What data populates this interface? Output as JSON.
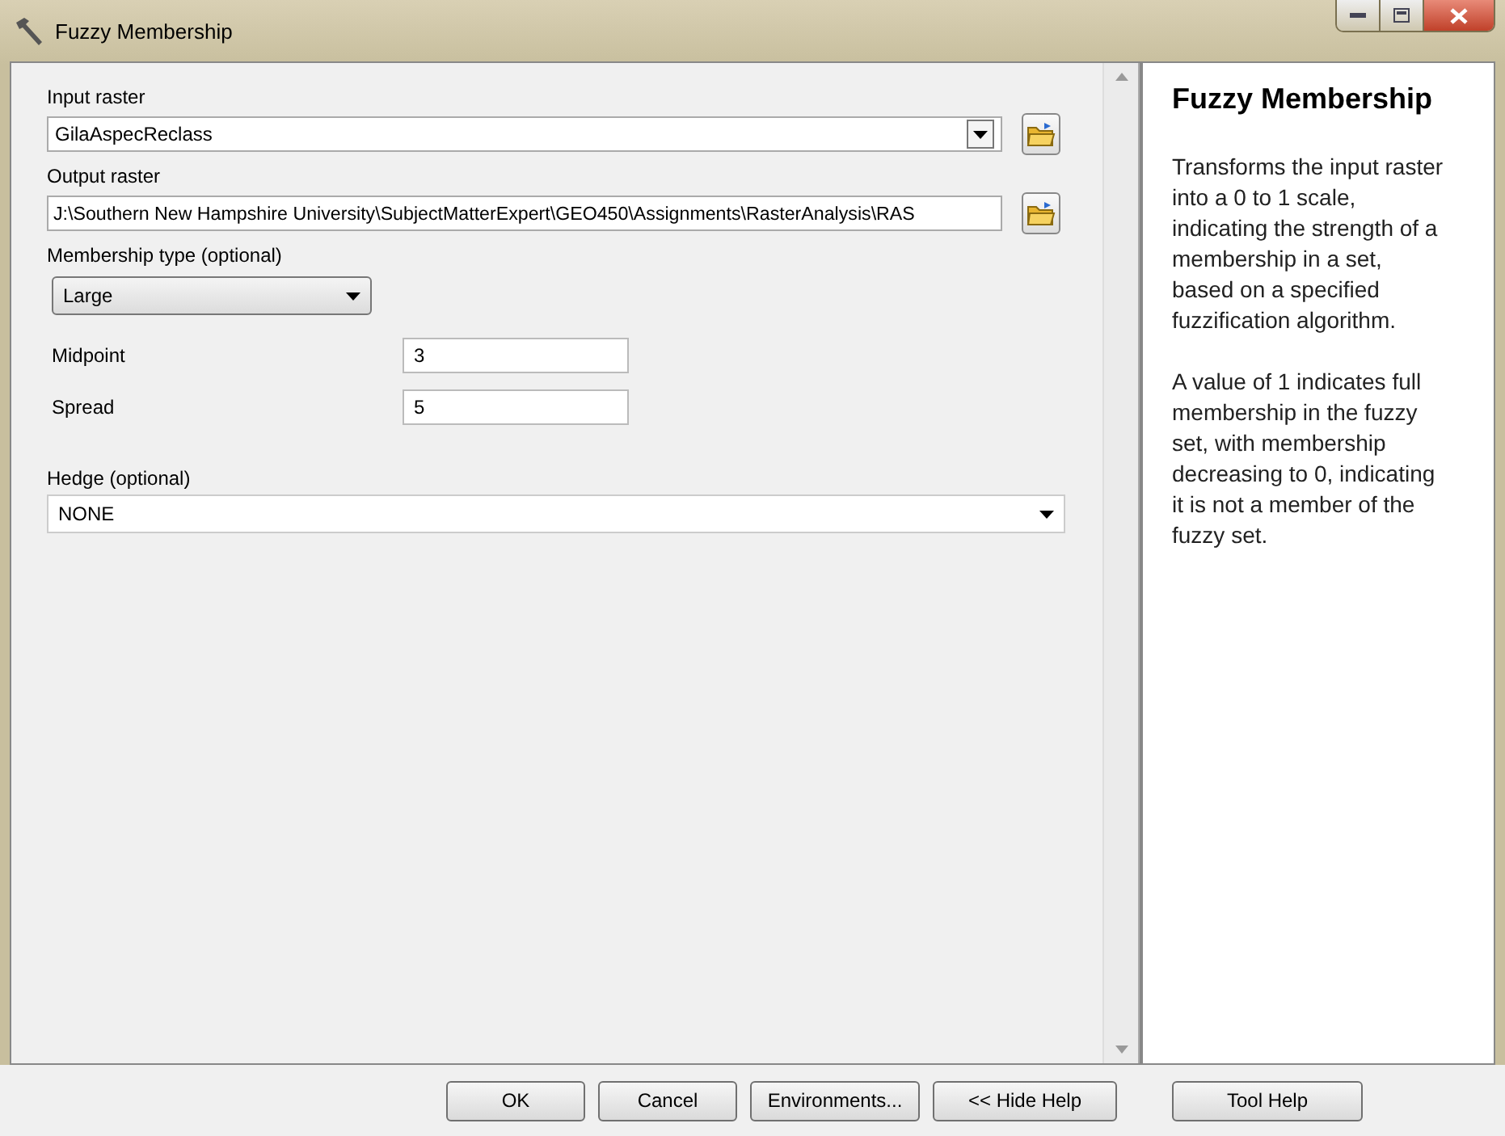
{
  "window": {
    "title": "Fuzzy Membership"
  },
  "parameters": [
    {
      "kind": "combo",
      "label": "Input raster",
      "value": "GilaAspecReclass",
      "browse": true
    },
    {
      "kind": "text",
      "label": "Output raster",
      "value": "J:\\Southern New Hampshire University\\SubjectMatterExpert\\GEO450\\Assignments\\RasterAnalysis\\RAS",
      "browse": true
    },
    {
      "kind": "dropdown",
      "label": "Membership type (optional)",
      "value": "Large"
    },
    {
      "kind": "number",
      "label": "Midpoint",
      "value": "3"
    },
    {
      "kind": "number",
      "label": "Spread",
      "value": "5"
    },
    {
      "kind": "wide-dropdown",
      "label": "Hedge (optional)",
      "value": "NONE"
    }
  ],
  "help": {
    "title": "Fuzzy Membership",
    "paragraphs": [
      "Transforms the input raster into a 0 to 1 scale, indicating the strength of a membership in a set, based on a specified fuzzification algorithm.",
      "A value of 1 indicates full membership in the fuzzy set, with membership decreasing to 0, indicating it is not a member of the fuzzy set."
    ]
  },
  "buttons": [
    {
      "label": "OK",
      "kind": "action"
    },
    {
      "label": "Cancel",
      "kind": "action"
    },
    {
      "label": "Environments...",
      "kind": "action"
    },
    {
      "label": "<< Hide Help",
      "kind": "action"
    },
    {
      "label": "Tool Help",
      "kind": "separate"
    }
  ]
}
